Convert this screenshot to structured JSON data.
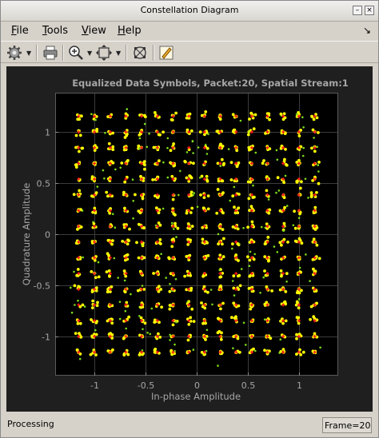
{
  "window": {
    "title": "Constellation Diagram"
  },
  "menu": {
    "file": {
      "u": "F",
      "rest": "ile"
    },
    "tools": {
      "u": "T",
      "rest": "ools"
    },
    "view": {
      "u": "V",
      "rest": "iew"
    },
    "help": {
      "u": "H",
      "rest": "elp"
    }
  },
  "toolbar": {
    "icons": [
      "gear-icon",
      "print-icon",
      "zoom-in-icon",
      "fit-to-view-icon",
      "autoscale-icon",
      "highlight-icon"
    ]
  },
  "colors": {
    "figure_bg": "#1f1f1f",
    "axes_bg": "#000000",
    "grid": "#3c3c3c",
    "axis_text": "#a6a6a6",
    "received": "#ffff00",
    "received_outlier": "#7cdc1a",
    "reference": "#ff1a1a"
  },
  "chart_data": {
    "type": "scatter",
    "title": "Equalized Data Symbols, Packet:20, Spatial Stream:1",
    "xlabel": "In-phase Amplitude",
    "ylabel": "Quadrature Amplitude",
    "xlim": [
      -1.38,
      1.38
    ],
    "ylim": [
      -1.38,
      1.38
    ],
    "xticks": [
      -1,
      -0.5,
      0,
      0.5,
      1
    ],
    "xtick_labels": [
      "-1",
      "-0.5",
      "0",
      "0.5",
      "1"
    ],
    "yticks": [
      1,
      0.5,
      0,
      -0.5,
      -1
    ],
    "ytick_labels": [
      "1",
      "0.5",
      "0",
      "-0.5",
      "-1"
    ],
    "grid": true,
    "reference_constellation": {
      "name": "256-QAM reference points",
      "levels": [
        -15,
        -13,
        -11,
        -9,
        -7,
        -5,
        -3,
        -1,
        1,
        3,
        5,
        7,
        9,
        11,
        13,
        15
      ],
      "scale": 0.0767
    },
    "received_spread_std": 0.017,
    "received_outlier_fraction": 0.12
  },
  "status": {
    "left": "Processing",
    "frame": "Frame=20"
  }
}
